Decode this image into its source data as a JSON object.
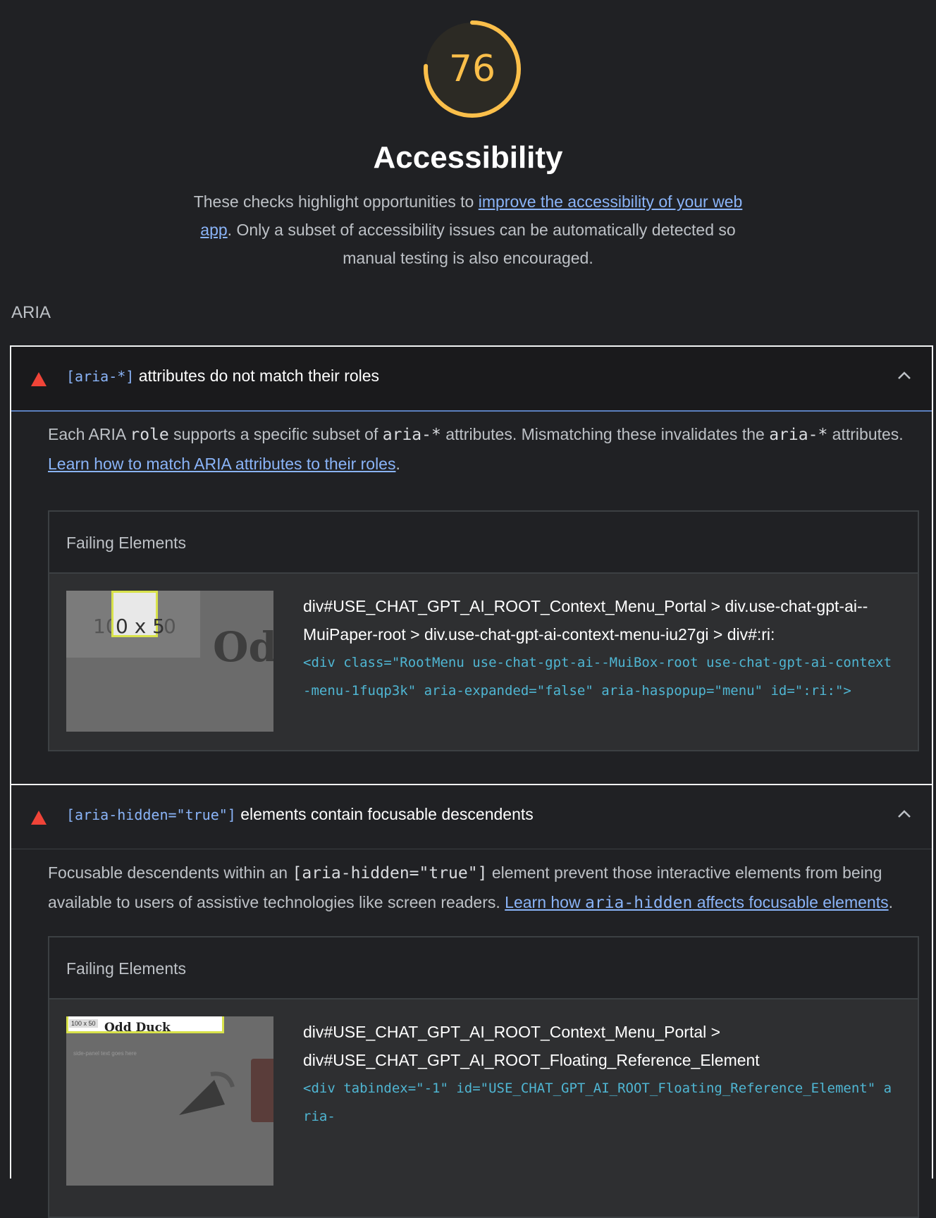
{
  "category": {
    "score": "76",
    "score_fraction": 0.76,
    "title": "Accessibility",
    "desc_pre": "These checks highlight opportunities to ",
    "desc_link": "improve the accessibility of your web app",
    "desc_post": ". Only a subset of accessibility issues can be automatically detected so manual testing is also encouraged.",
    "color": "#fbbf4a"
  },
  "group": {
    "title": "ARIA"
  },
  "audits": [
    {
      "title_code": "[aria-*]",
      "title_text": " attributes do not match their roles",
      "desc_parts": {
        "p1": "Each ARIA ",
        "c1": "role",
        "p2": " supports a specific subset of ",
        "c2": "aria-*",
        "p3": " attributes. Mismatching these invalidates the ",
        "c3": "aria-*",
        "p4": " attributes. ",
        "link": "Learn how to match ARIA attributes to their roles",
        "p5": "."
      },
      "table_header": "Failing Elements",
      "item": {
        "selector": "div#USE_CHAT_GPT_AI_ROOT_Context_Menu_Portal > div.use-chat-gpt-ai--MuiPaper-root > div.use-chat-gpt-ai-context-menu-iu27gi > div#:ri:",
        "snippet": "<div class=\"RootMenu use-chat-gpt-ai--MuiBox-root use-chat-gpt-ai-context-menu-1fuqp3k\" aria-expanded=\"false\" aria-haspopup=\"menu\" id=\":ri:\">",
        "thumb_label_a": "10",
        "thumb_label_b": "0 x 5",
        "thumb_label_c": "0",
        "thumb_text": "Od"
      }
    },
    {
      "title_code": "[aria-hidden=\"true\"]",
      "title_text": " elements contain focusable descendents",
      "desc_parts": {
        "p1": "Focusable descendents within an ",
        "c1": "[aria-hidden=\"true\"]",
        "p2": " element prevent those interactive elements from being available to users of assistive technologies like screen readers. ",
        "link_pre": "Learn how ",
        "link_code": "aria-hidden",
        "link_post": " affects focusable elements",
        "p3": "."
      },
      "table_header": "Failing Elements",
      "item": {
        "selector": "div#USE_CHAT_GPT_AI_ROOT_Context_Menu_Portal > div#USE_CHAT_GPT_AI_ROOT_Floating_Reference_Element",
        "snippet": "<div tabindex=\"-1\" id=\"USE_CHAT_GPT_AI_ROOT_Floating_Reference_Element\" aria-",
        "thumb_label": "100 x 50",
        "thumb_title": "Odd Duck",
        "thumb_sub": "side-panel text goes here"
      }
    }
  ]
}
